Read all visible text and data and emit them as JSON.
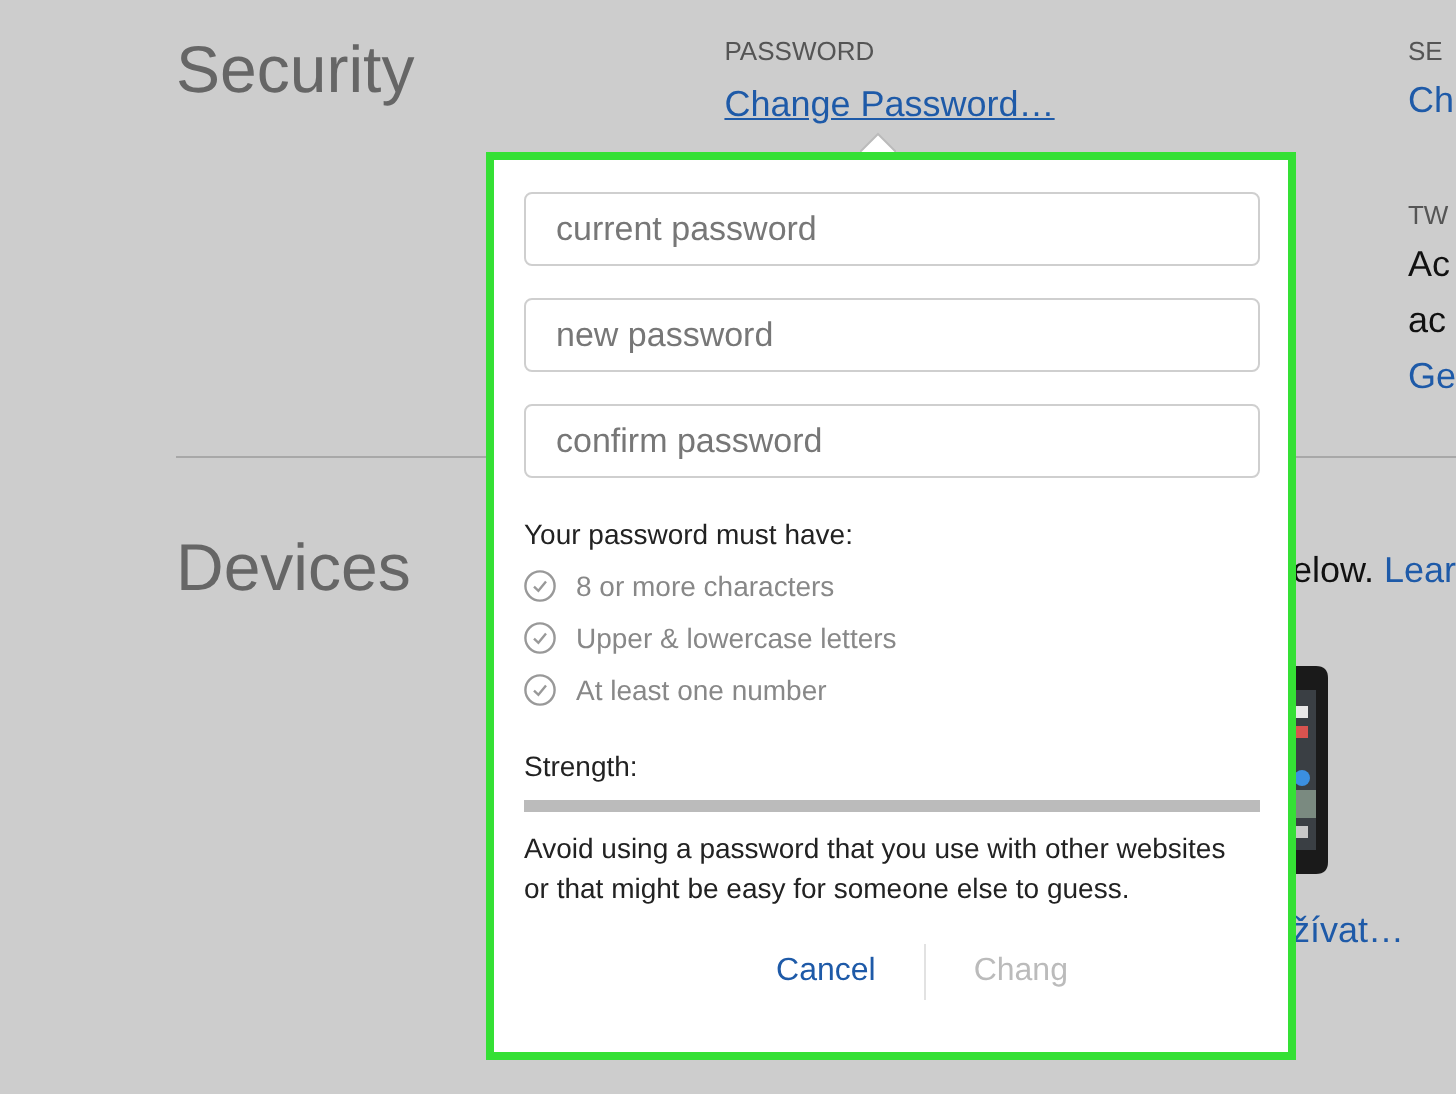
{
  "security": {
    "title": "Security",
    "password": {
      "label": "PASSWORD",
      "link": "Change Password…"
    },
    "column_3": {
      "label": "SE",
      "link": "Ch",
      "label_2": "TW",
      "text_lines": [
        "Ac",
        "ac"
      ],
      "link_2": "Ge"
    }
  },
  "devices": {
    "title": "Devices",
    "text": "elow.",
    "link": "Lear",
    "link_2": "žívat…"
  },
  "dialog": {
    "fields": [
      {
        "placeholder": "current password"
      },
      {
        "placeholder": "new password"
      },
      {
        "placeholder": "confirm password"
      }
    ],
    "requirements_title": "Your password must have:",
    "requirements": [
      {
        "label": "8 or more characters",
        "met": false
      },
      {
        "label": "Upper & lowercase letters",
        "met": false
      },
      {
        "label": "At least one number",
        "met": false
      }
    ],
    "strength": {
      "label": "Strength:",
      "level": 0
    },
    "advice": "Avoid using a password that you use with other websites or that might be easy for someone else to guess.",
    "buttons": [
      {
        "label": "Cancel",
        "disabled": false
      },
      {
        "label": "Chang",
        "disabled": true
      }
    ]
  }
}
